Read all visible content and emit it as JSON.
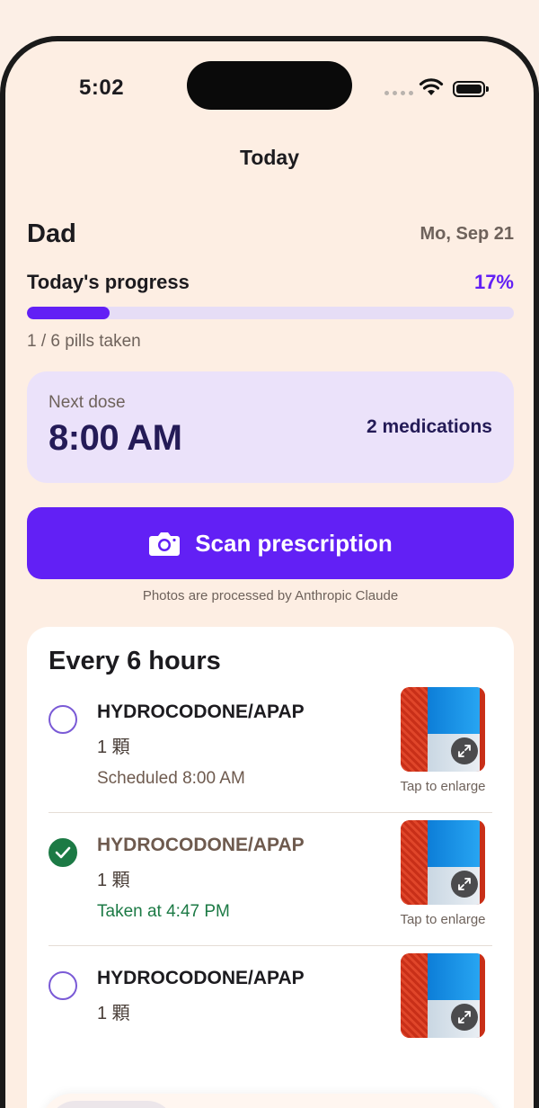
{
  "status_bar": {
    "time": "5:02"
  },
  "nav": {
    "title": "Today"
  },
  "header": {
    "patient_name": "Dad",
    "date": "Mo, Sep 21"
  },
  "progress": {
    "label": "Today's progress",
    "percent_text": "17%",
    "fraction": 0.17,
    "pills_taken": "1 / 6 pills taken"
  },
  "next_dose": {
    "label": "Next dose",
    "time": "8:00 AM",
    "medications": "2 medications"
  },
  "scan": {
    "button_label": "Scan prescription",
    "note": "Photos are processed by Anthropic Claude"
  },
  "schedule": {
    "title": "Every 6 hours",
    "items": [
      {
        "name": "HYDROCODONE/APAP",
        "qty": "1 顆",
        "status": "Scheduled 8:00 AM",
        "taken": false,
        "tap": "Tap to enlarge"
      },
      {
        "name": "HYDROCODONE/APAP",
        "qty": "1 顆",
        "status": "Taken at 4:47 PM",
        "taken": true,
        "tap": "Tap to enlarge"
      },
      {
        "name": "HYDROCODONE/APAP",
        "qty": "1 顆",
        "status": "",
        "taken": false,
        "tap": ""
      }
    ]
  },
  "colors": {
    "accent": "#6220f5",
    "success": "#1c7a45",
    "background": "#fdeee3",
    "next_dose_bg": "#ebe2fa"
  }
}
